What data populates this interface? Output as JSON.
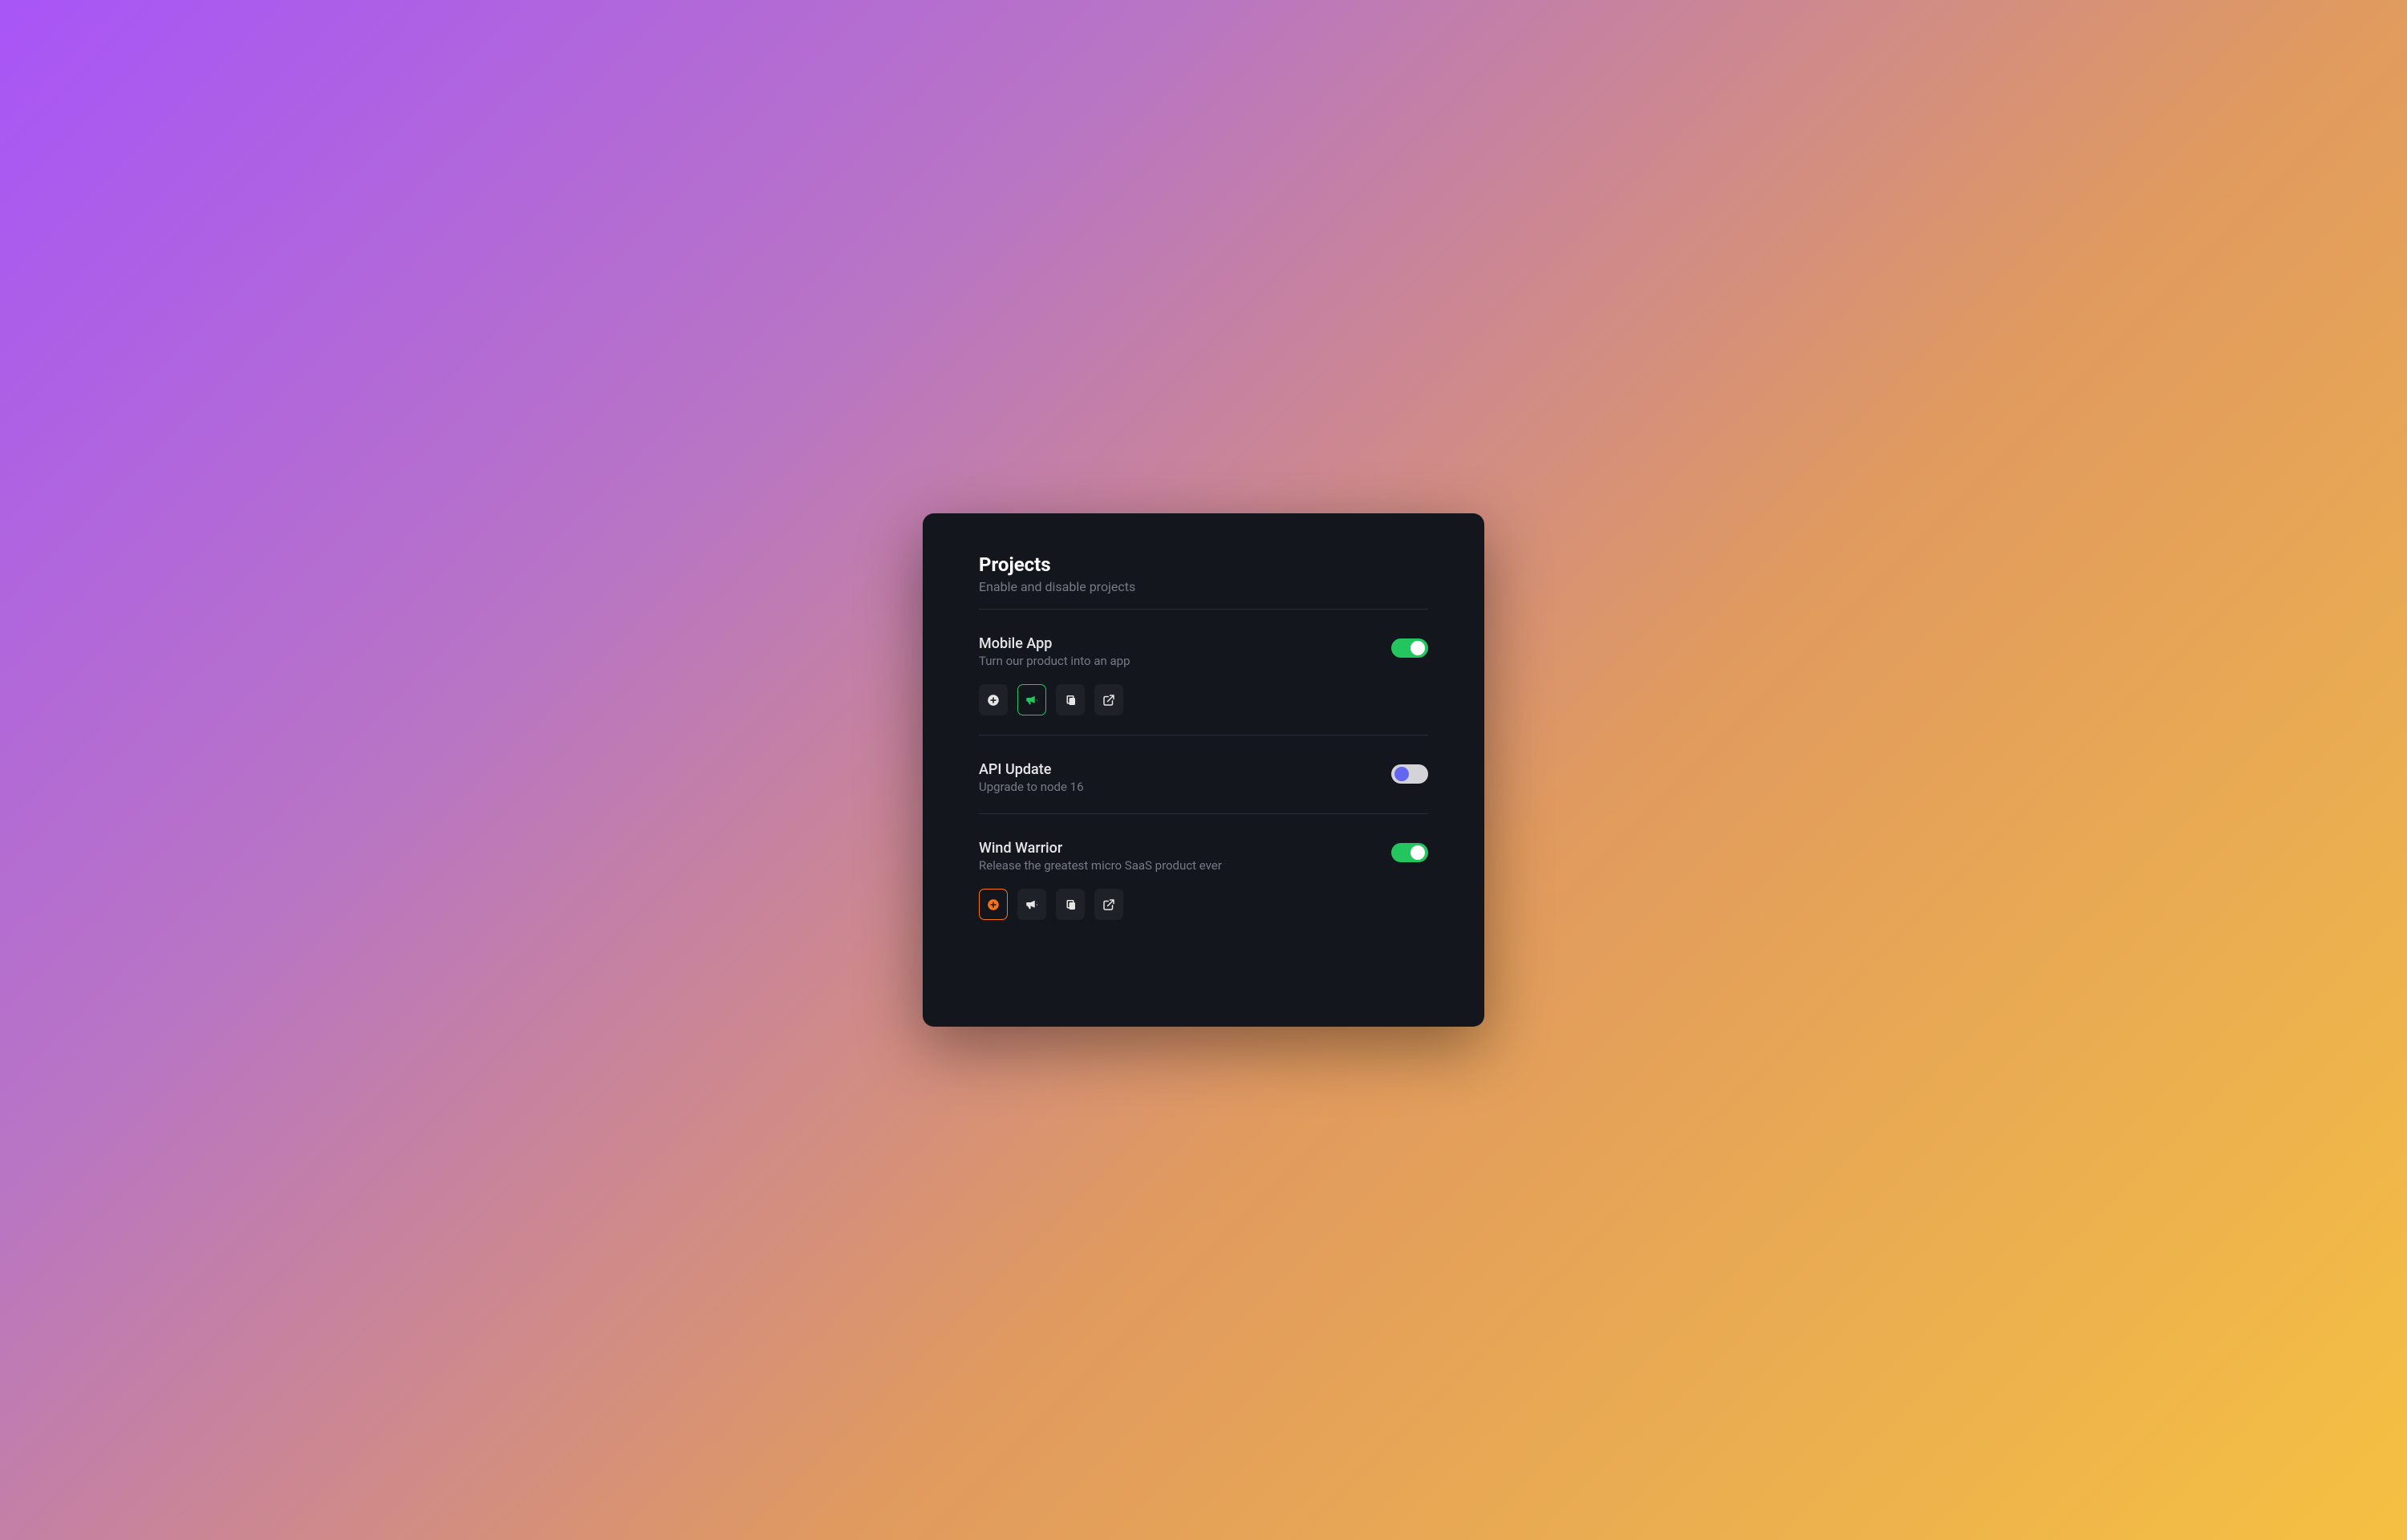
{
  "header": {
    "title": "Projects",
    "subtitle": "Enable and disable projects"
  },
  "projects": [
    {
      "title": "Mobile App",
      "description": "Turn our product into an app",
      "enabled": true,
      "showActions": true,
      "activeAction": 1,
      "activeColor": "green"
    },
    {
      "title": "API Update",
      "description": "Upgrade to node 16",
      "enabled": false,
      "showActions": false
    },
    {
      "title": "Wind Warrior",
      "description": "Release the greatest micro SaaS product ever",
      "enabled": true,
      "showActions": true,
      "activeAction": 0,
      "activeColor": "orange"
    }
  ],
  "actionIcons": [
    "plus-circle-icon",
    "megaphone-icon",
    "copy-icon",
    "external-link-icon"
  ]
}
